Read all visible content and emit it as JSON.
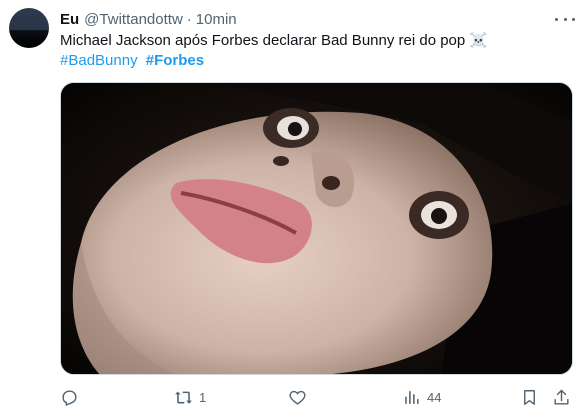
{
  "tweet": {
    "author_name": "Eu",
    "author_handle": "@Twittandottw",
    "separator": "·",
    "time": "10min",
    "text": "Michael Jackson após Forbes declarar Bad Bunny rei do pop ☠️",
    "hashtags": [
      "#BadBunny",
      "#Forbes"
    ],
    "media_icon": "meme-photo"
  },
  "actions": {
    "reply_count": "",
    "retweet_count": "1",
    "like_count": "",
    "views_count": "44"
  },
  "icons": {
    "reply": "reply-icon",
    "retweet": "retweet-icon",
    "like": "heart-icon",
    "views": "analytics-icon",
    "bookmark": "bookmark-icon",
    "share": "share-icon",
    "more": "more-icon"
  },
  "colors": {
    "link": "#1d9bf0",
    "secondary_text": "#536471",
    "primary_text": "#0f1419"
  }
}
